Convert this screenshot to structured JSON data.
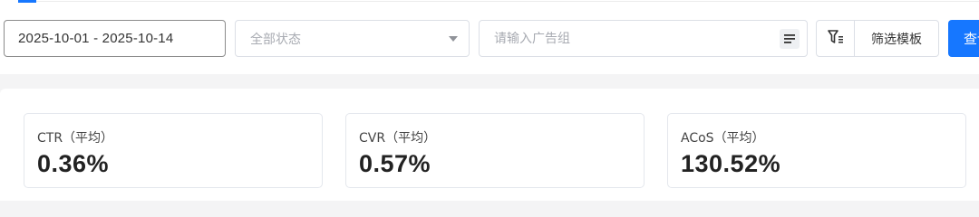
{
  "toolbar": {
    "date_range": "2025-10-01 - 2025-10-14",
    "status_placeholder": "全部状态",
    "ad_group_placeholder": "请输入广告组",
    "filter_template_label": "筛选模板",
    "query_label": "查询"
  },
  "icons": {
    "caret": "chevron-down-icon",
    "list": "list-icon",
    "filter": "filter-icon"
  },
  "colors": {
    "accent": "#1677ff",
    "background": "#f4f4f5"
  },
  "metrics": [
    {
      "label": "CTR（平均）",
      "value": "0.36%"
    },
    {
      "label": "CVR（平均）",
      "value": "0.57%"
    },
    {
      "label": "ACoS（平均）",
      "value": "130.52%"
    }
  ]
}
